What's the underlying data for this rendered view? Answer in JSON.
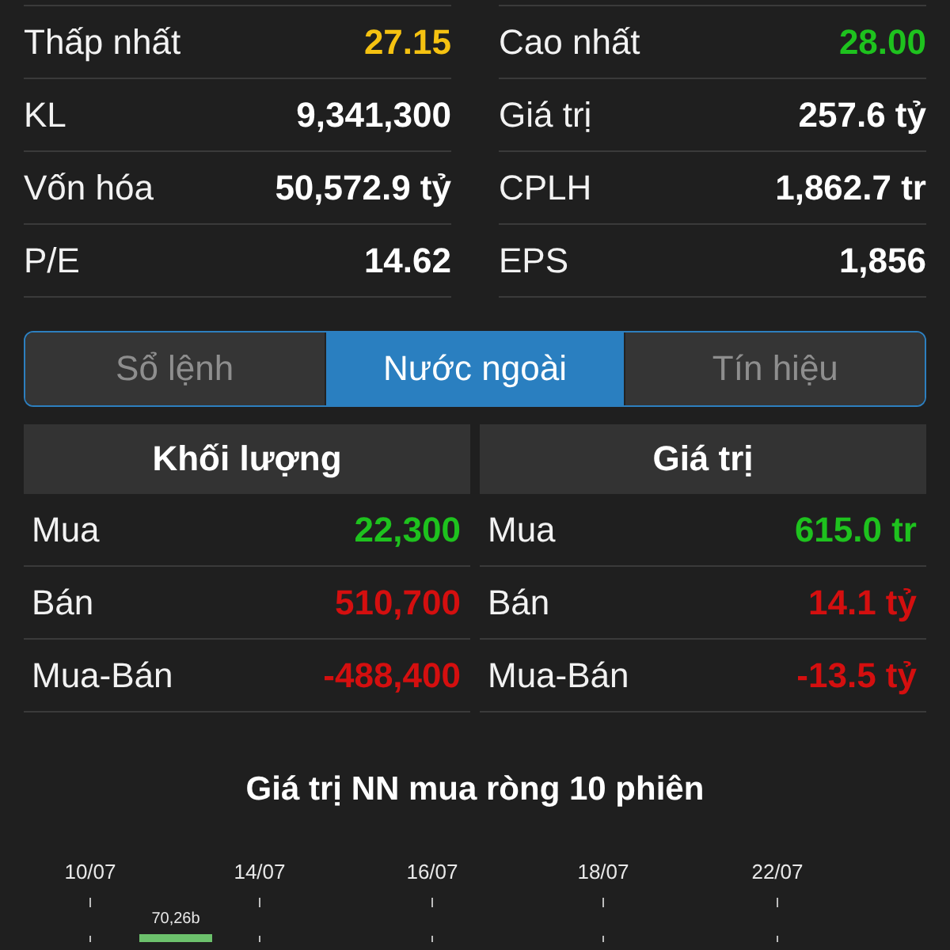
{
  "stats": {
    "left": [
      {
        "label": "Thấp nhất",
        "value": "27.15",
        "color": "#f5c211"
      },
      {
        "label": "KL",
        "value": "9,341,300",
        "color": "#ffffff"
      },
      {
        "label": "Vốn hóa",
        "value": "50,572.9 tỷ",
        "color": "#ffffff"
      },
      {
        "label": "P/E",
        "value": "14.62",
        "color": "#ffffff"
      }
    ],
    "right": [
      {
        "label": "Cao nhất",
        "value": "28.00",
        "color": "#1ec21e"
      },
      {
        "label": "Giá trị",
        "value": "257.6 tỷ",
        "color": "#ffffff"
      },
      {
        "label": "CPLH",
        "value": "1,862.7 tr",
        "color": "#ffffff"
      },
      {
        "label": "EPS",
        "value": "1,856",
        "color": "#ffffff"
      }
    ]
  },
  "tabs": [
    {
      "label": "Sổ lệnh",
      "selected": false
    },
    {
      "label": "Nước ngoài",
      "selected": true
    },
    {
      "label": "Tín hiệu",
      "selected": false
    }
  ],
  "foreign": [
    {
      "header": "Khối lượng",
      "rows": [
        {
          "label": "Mua",
          "value": "22,300",
          "color": "#1ec21e"
        },
        {
          "label": "Bán",
          "value": "510,700",
          "color": "#d40f0f"
        },
        {
          "label": "Mua-Bán",
          "value": "-488,400",
          "color": "#d40f0f"
        }
      ]
    },
    {
      "header": "Giá trị",
      "rows": [
        {
          "label": "Mua",
          "value": "615.0 tr",
          "color": "#1ec21e"
        },
        {
          "label": "Bán",
          "value": "14.1 tỷ",
          "color": "#d40f0f"
        },
        {
          "label": "Mua-Bán",
          "value": "-13.5 tỷ",
          "color": "#d40f0f"
        }
      ]
    }
  ],
  "chart": {
    "title": "Giá trị NN mua ròng 10 phiên",
    "dates": [
      "10/07",
      "14/07",
      "16/07",
      "18/07",
      "22/07"
    ],
    "bar_label": "70,26b"
  }
}
